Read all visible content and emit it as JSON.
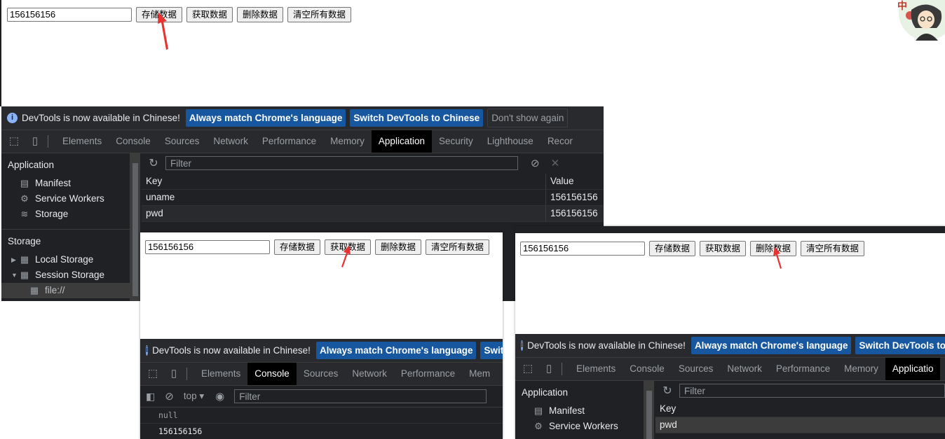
{
  "input_value": "156156156",
  "buttons": {
    "store": "存储数据",
    "get": "获取数据",
    "delete": "删除数据",
    "clear": "清空所有数据"
  },
  "avatar_char": "中",
  "infobar": {
    "text": "DevTools is now available in Chinese!",
    "match_btn": "Always match Chrome's language",
    "switch_btn": "Switch DevTools to Chinese",
    "switch_btn_cut": "Switch D",
    "switch_btn_cut2": "Switch DevTools to Chin",
    "dismiss_btn": "Don't show again"
  },
  "tabs": {
    "elements": "Elements",
    "console": "Console",
    "sources": "Sources",
    "network": "Network",
    "performance": "Performance",
    "memory": "Memory",
    "application": "Application",
    "security": "Security",
    "lighthouse": "Lighthouse",
    "recorder_cut": "Recor",
    "memory_cut": "Mem",
    "application_cut": "Applicatio"
  },
  "sidebar": {
    "application_head": "Application",
    "manifest": "Manifest",
    "service_workers": "Service Workers",
    "storage": "Storage",
    "storage_head": "Storage",
    "local_storage": "Local Storage",
    "session_storage": "Session Storage",
    "file": "file://"
  },
  "filter_placeholder": "Filter",
  "table": {
    "key_header": "Key",
    "value_header": "Value",
    "rows": [
      {
        "key": "uname",
        "value": "156156156"
      },
      {
        "key": "pwd",
        "value": "156156156"
      }
    ],
    "after_delete_row": {
      "key": "pwd"
    }
  },
  "console": {
    "context": "top",
    "lines": [
      "null",
      "156156156"
    ]
  },
  "colors": {
    "accent_arrow": "#e8322f",
    "devtools_bg": "#202124",
    "infobar_btn": "#16579f"
  }
}
